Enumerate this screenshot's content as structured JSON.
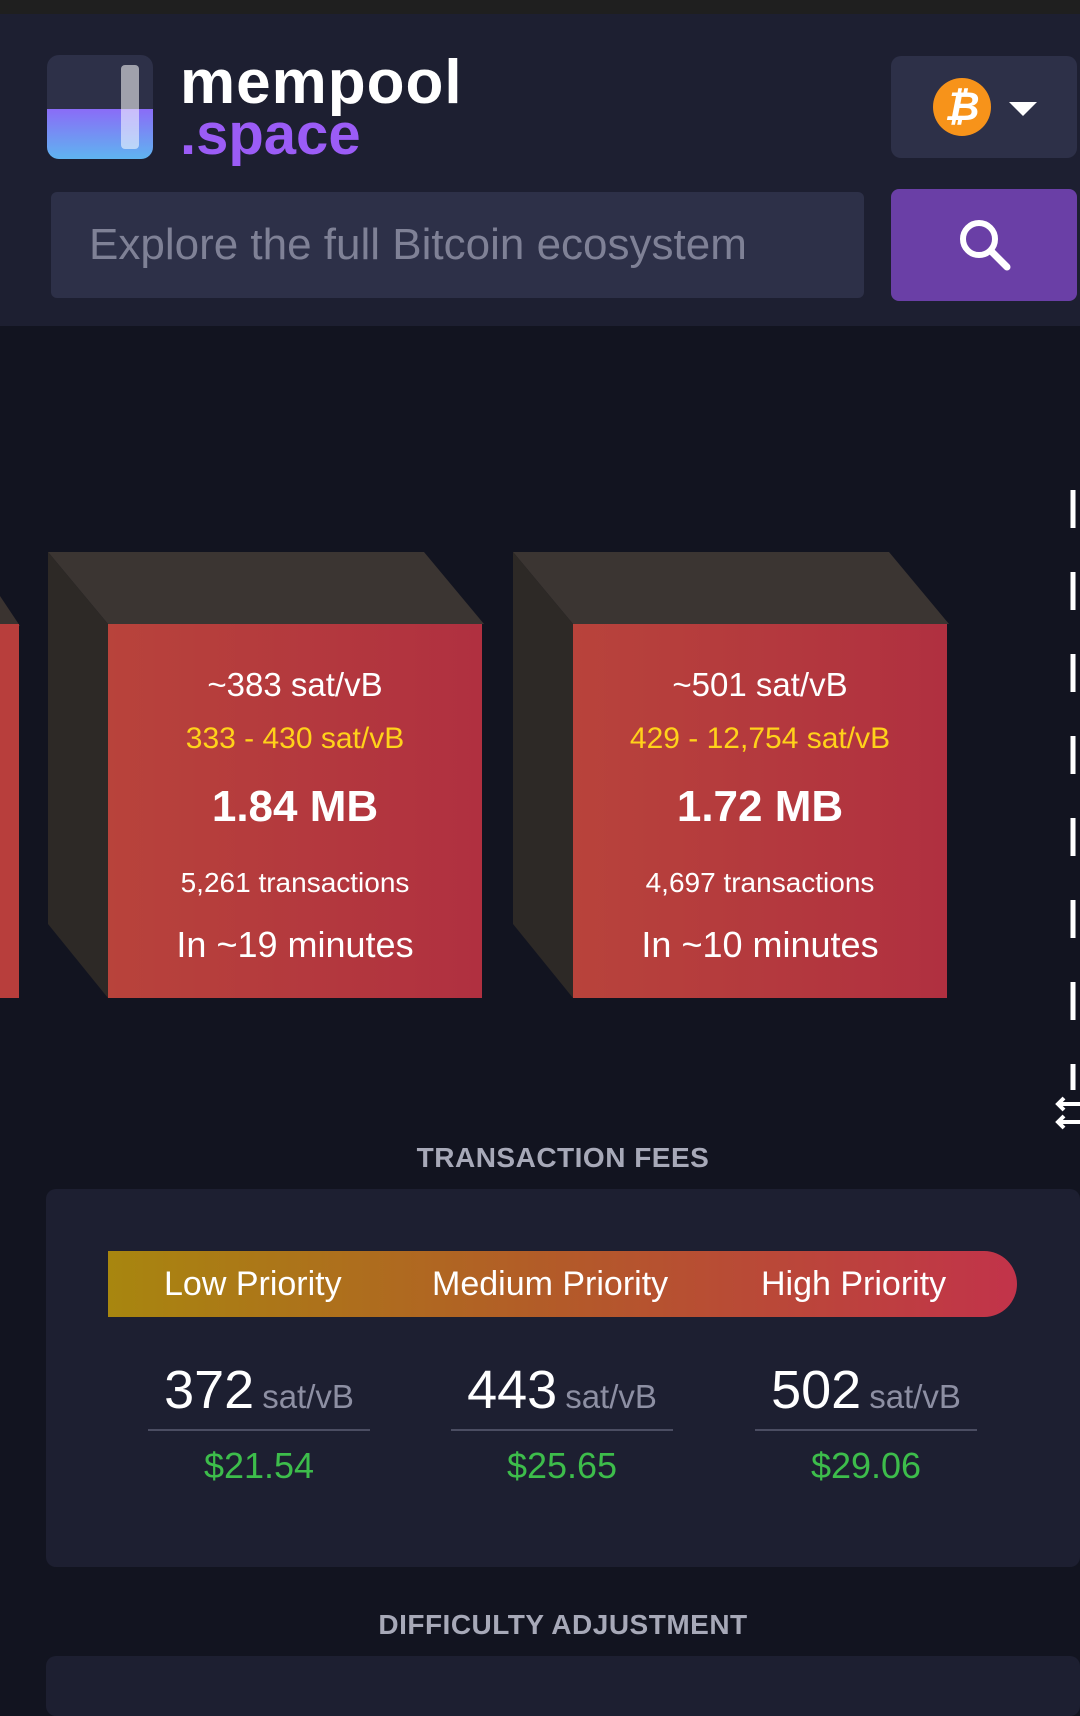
{
  "header": {
    "logo_line1": "mempool",
    "logo_line2": ".space",
    "network_icon": "bitcoin-icon",
    "search_placeholder": "Explore the full Bitcoin ecosystem"
  },
  "blocks": [
    {
      "median_fee": "~383 sat/vB",
      "fee_range": "333 - 430 sat/vB",
      "size": "1.84 MB",
      "tx_count": "5,261 transactions",
      "eta": "In ~19 minutes"
    },
    {
      "median_fee": "~501 sat/vB",
      "fee_range": "429 - 12,754 sat/vB",
      "size": "1.72 MB",
      "tx_count": "4,697 transactions",
      "eta": "In ~10 minutes"
    }
  ],
  "fees": {
    "title": "TRANSACTION FEES",
    "low_label": "Low Priority",
    "medium_label": "Medium Priority",
    "high_label": "High Priority",
    "unit": "sat/vB",
    "low_value": "372",
    "low_usd": "$21.54",
    "medium_value": "443",
    "medium_usd": "$25.65",
    "high_value": "502",
    "high_usd": "$29.06"
  },
  "difficulty": {
    "title": "DIFFICULTY ADJUSTMENT"
  },
  "colors": {
    "accent": "#9b5cf6",
    "btc": "#f7931a",
    "fee_range": "#ffd21a",
    "usd": "#3dbd4b"
  }
}
